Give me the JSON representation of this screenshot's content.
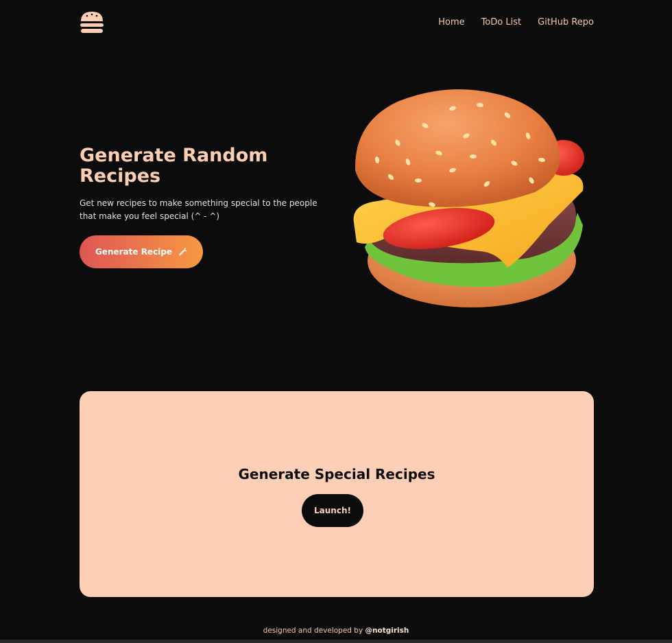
{
  "nav": {
    "logo_icon": "burger-icon",
    "links": [
      "Home",
      "ToDo List",
      "GitHub Repo"
    ]
  },
  "hero": {
    "title": "Generate Random Recipes",
    "subtitle": "Get new recipes to make something special to the people that make you feel special (^ - ^)",
    "button_label": "Generate Recipe",
    "button_icon": "carrot-icon",
    "image": "burger-illustration"
  },
  "card": {
    "title": "Generate Special Recipes",
    "button_label": "Launch!"
  },
  "footer": {
    "text": "designed and developed by",
    "author": "@notgirish"
  },
  "colors": {
    "background": "#0d0c0c",
    "accent_peach": "#fccfb6",
    "gradient_start": "#de5554",
    "gradient_end": "#f79a42"
  }
}
